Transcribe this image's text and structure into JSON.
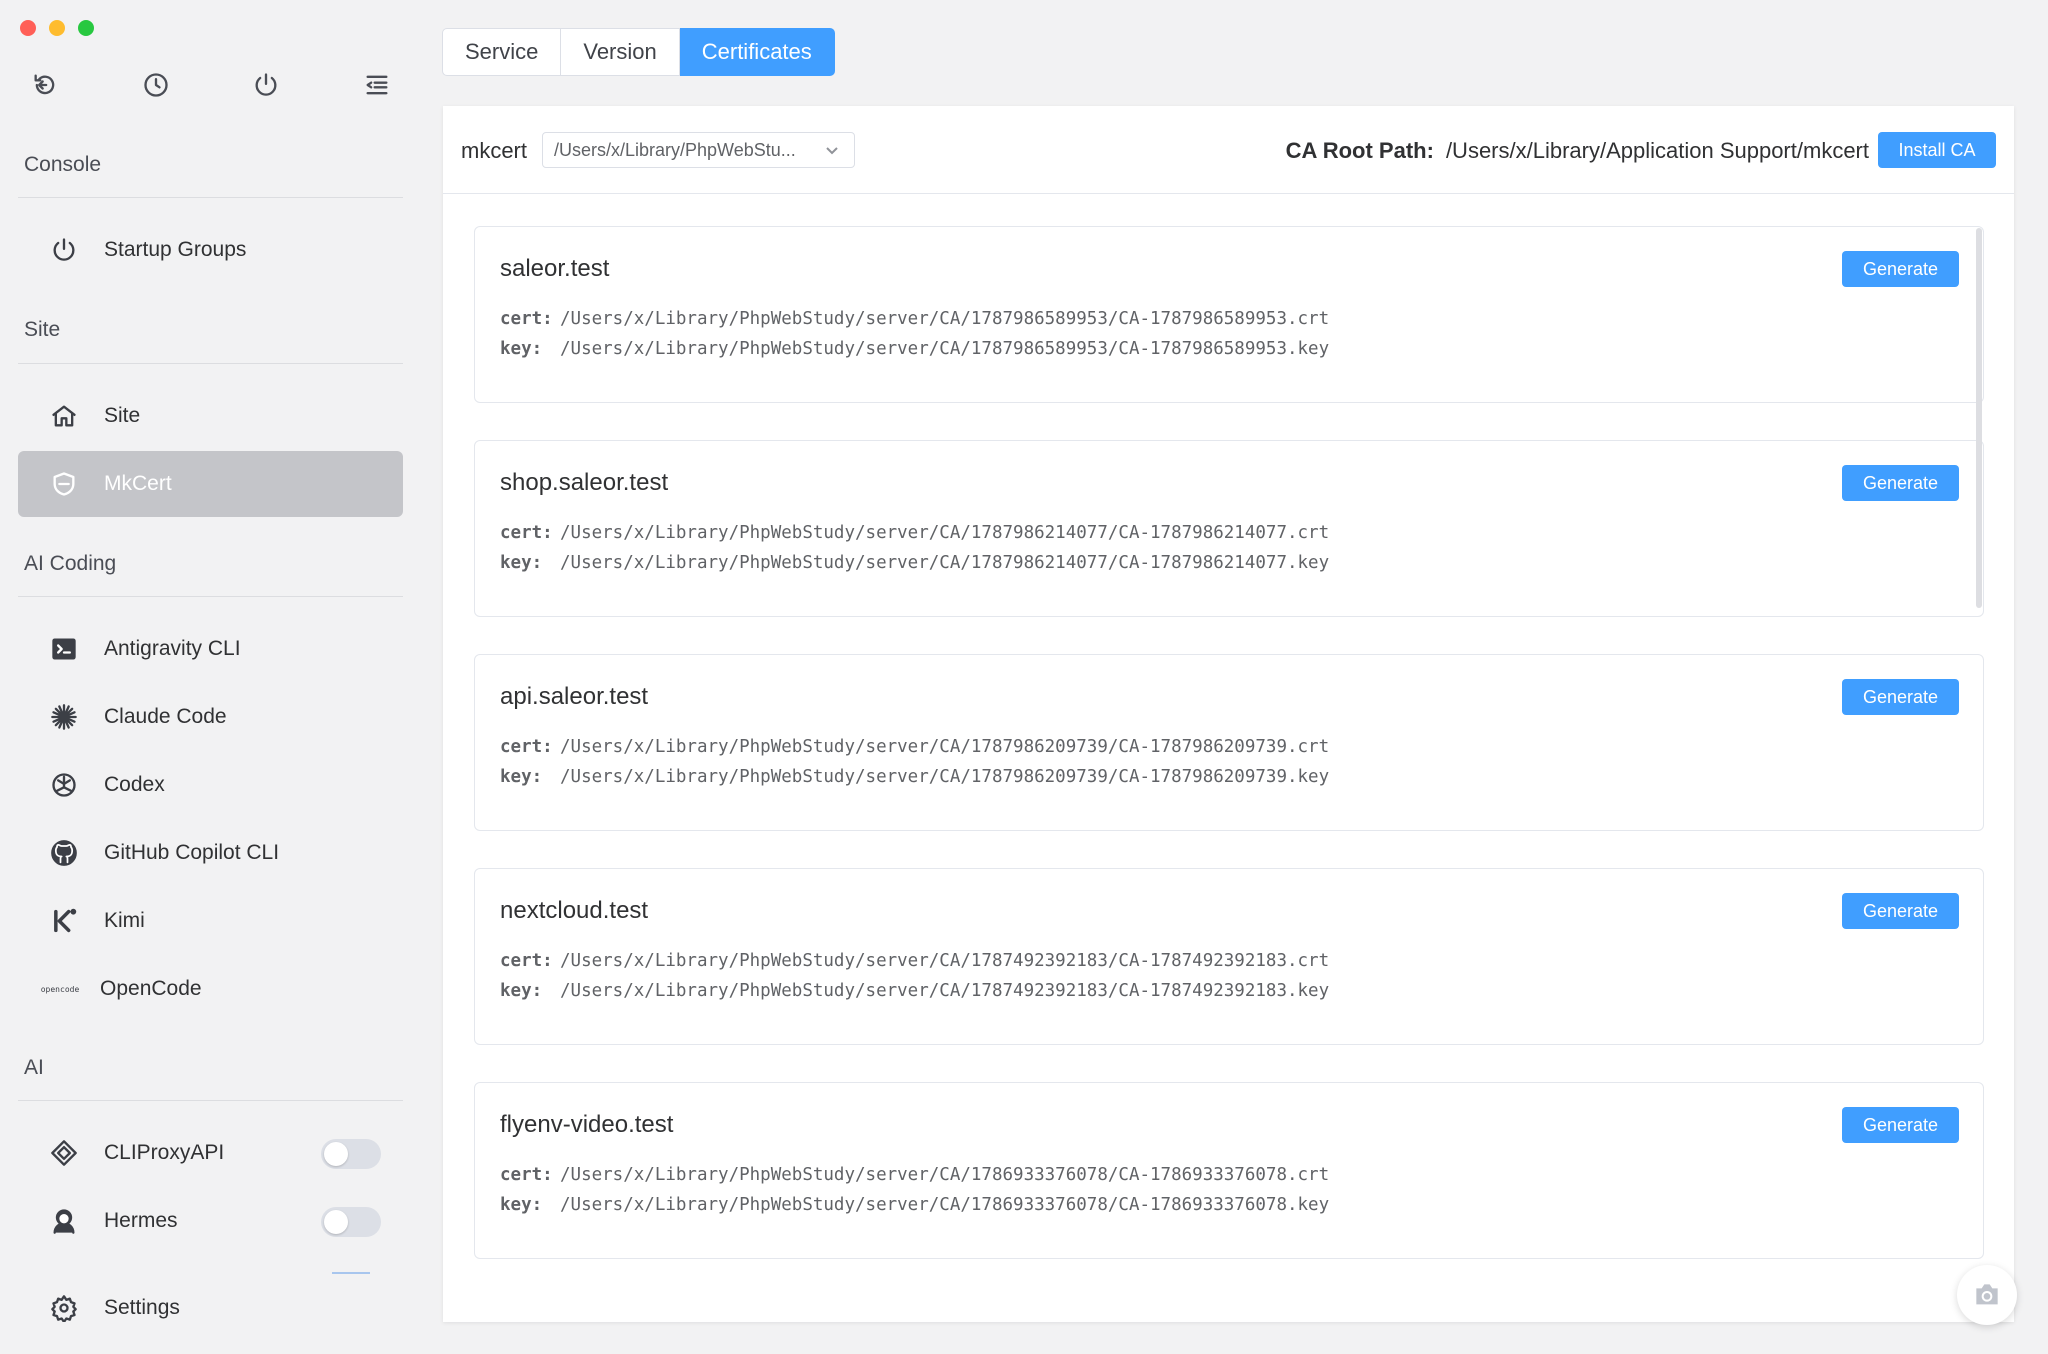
{
  "sidebar": {
    "sections": {
      "console": "Console",
      "site": "Site",
      "ai_coding": "AI Coding",
      "ai": "AI"
    },
    "items": {
      "startup_groups": "Startup Groups",
      "site": "Site",
      "mkcert": "MkCert",
      "antigravity": "Antigravity CLI",
      "claude": "Claude Code",
      "codex": "Codex",
      "copilot": "GitHub Copilot CLI",
      "kimi": "Kimi",
      "opencode": "OpenCode",
      "cliproxy": "CLIProxyAPI",
      "hermes": "Hermes",
      "settings": "Settings"
    },
    "toggles": {
      "cliproxy": false,
      "hermes": false
    },
    "opencode_logo_text": "opencode"
  },
  "tabs": [
    "Service",
    "Version",
    "Certificates"
  ],
  "active_tab": "Certificates",
  "header": {
    "mkcert_label": "mkcert",
    "select_value": "/Users/x/Library/PhpWebStu...",
    "ca_root_label": "CA Root Path:",
    "ca_root_value": "/Users/x/Library/Application Support/mkcert",
    "install_label": "Install CA"
  },
  "cert_label": "cert:",
  "key_label": "key:",
  "generate_label": "Generate",
  "certificates": [
    {
      "host": "saleor.test",
      "cert": "/Users/x/Library/PhpWebStudy/server/CA/1787986589953/CA-1787986589953.crt",
      "key": "/Users/x/Library/PhpWebStudy/server/CA/1787986589953/CA-1787986589953.key"
    },
    {
      "host": "shop.saleor.test",
      "cert": "/Users/x/Library/PhpWebStudy/server/CA/1787986214077/CA-1787986214077.crt",
      "key": "/Users/x/Library/PhpWebStudy/server/CA/1787986214077/CA-1787986214077.key"
    },
    {
      "host": "api.saleor.test",
      "cert": "/Users/x/Library/PhpWebStudy/server/CA/1787986209739/CA-1787986209739.crt",
      "key": "/Users/x/Library/PhpWebStudy/server/CA/1787986209739/CA-1787986209739.key"
    },
    {
      "host": "nextcloud.test",
      "cert": "/Users/x/Library/PhpWebStudy/server/CA/1787492392183/CA-1787492392183.crt",
      "key": "/Users/x/Library/PhpWebStudy/server/CA/1787492392183/CA-1787492392183.key"
    },
    {
      "host": "flyenv-video.test",
      "cert": "/Users/x/Library/PhpWebStudy/server/CA/1786933376078/CA-1786933376078.crt",
      "key": "/Users/x/Library/PhpWebStudy/server/CA/1786933376078/CA-1786933376078.key"
    }
  ],
  "colors": {
    "accent": "#409eff",
    "sidebar_bg": "#f2f2f3",
    "active_item_bg": "#c4c5c9"
  }
}
